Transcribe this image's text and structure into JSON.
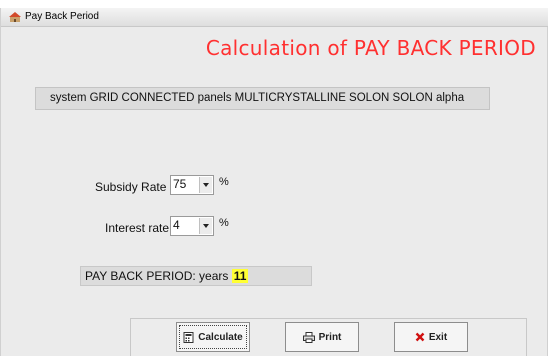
{
  "window": {
    "title": "Pay Back Period"
  },
  "heading": "Calculation of PAY BACK PERIOD",
  "system_description": "system GRID CONNECTED panels MULTICRYSTALLINE SOLON SOLON alpha",
  "subsidy": {
    "label": "Subsidy Rate",
    "value": "75",
    "unit": "%"
  },
  "interest": {
    "label": "Interest rate",
    "value": "4",
    "unit": "%"
  },
  "result": {
    "label": "PAY BACK PERIOD: years",
    "value": "11",
    "highlight_color": "#ffff33"
  },
  "buttons": {
    "calculate": "Calculate",
    "print": "Print",
    "exit": "Exit"
  },
  "colors": {
    "heading": "#ff3030",
    "exit_icon": "#d01010"
  }
}
